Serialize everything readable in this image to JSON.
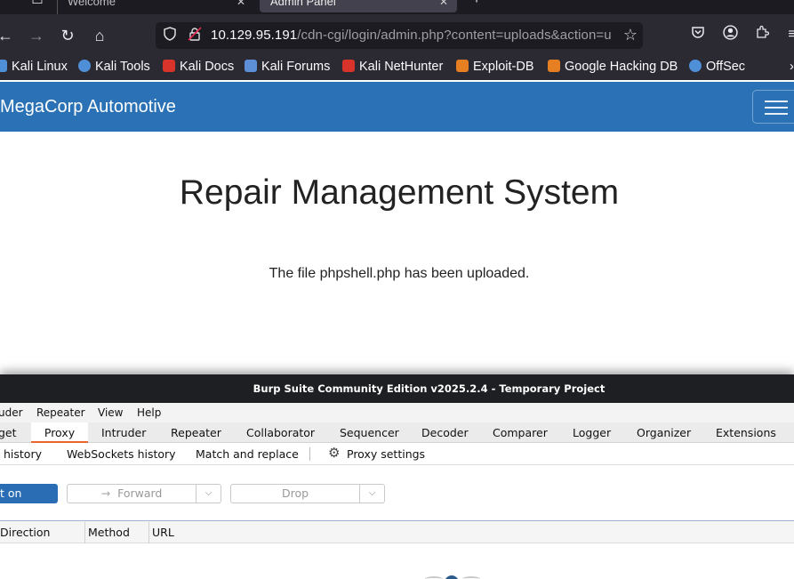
{
  "browser": {
    "tabs": [
      {
        "label": "Welcome"
      },
      {
        "label": "Admin Panel"
      }
    ],
    "url": {
      "host": "10.129.95.191",
      "path": "/cdn-cgi/login/admin.php?content=uploads&action=u"
    },
    "bookmarks": [
      {
        "label": "Kali Linux",
        "icon": "kali-dragon-icon",
        "color": "#4f8fd8"
      },
      {
        "label": "Kali Tools",
        "icon": "kali-tools-icon",
        "color": "#4f8fd8"
      },
      {
        "label": "Kali Docs",
        "icon": "kali-docs-icon",
        "color": "#d9342b"
      },
      {
        "label": "Kali Forums",
        "icon": "kali-forums-icon",
        "color": "#5d8fd8"
      },
      {
        "label": "Kali NetHunter",
        "icon": "nethunter-icon",
        "color": "#d9342b"
      },
      {
        "label": "Exploit-DB",
        "icon": "exploit-db-icon",
        "color": "#e67e22"
      },
      {
        "label": "Google Hacking DB",
        "icon": "ghdb-icon",
        "color": "#e67e22"
      },
      {
        "label": "OffSec",
        "icon": "offsec-icon",
        "color": "#4f8fd8"
      }
    ]
  },
  "site": {
    "brand": "MegaCorp Automotive",
    "title": "Repair Management System",
    "message": "The file phpshell.php has been uploaded.",
    "nav_color": "#2a72b5"
  },
  "burp": {
    "title": "Burp Suite Community Edition v2025.2.4 - Temporary Project",
    "menu": [
      "uder",
      "Repeater",
      "View",
      "Help"
    ],
    "tabs": [
      "get",
      "Proxy",
      "Intruder",
      "Repeater",
      "Collaborator",
      "Sequencer",
      "Decoder",
      "Comparer",
      "Logger",
      "Organizer",
      "Extensions"
    ],
    "active_tab": "Proxy",
    "subtabs": [
      "history",
      "WebSockets history",
      "Match and replace",
      "Proxy settings"
    ],
    "intercept_label": "t on",
    "forward_label": "Forward",
    "drop_label": "Drop",
    "columns": [
      "Direction",
      "Method",
      "URL"
    ],
    "accent": "#e8652b",
    "button_color": "#2a6db5"
  }
}
